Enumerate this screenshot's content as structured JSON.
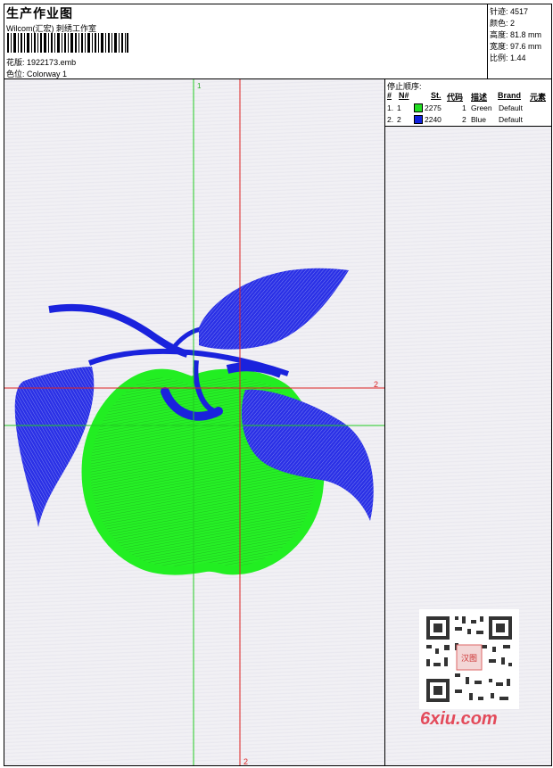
{
  "header": {
    "title": "生产作业图",
    "company": "Wilcom(汇宏) 刺绣工作室",
    "design_label": "花版:",
    "design_file": "1922173.emb",
    "colorway_label": "色位:",
    "colorway": "Colorway 1"
  },
  "stats": {
    "stitches_label": "针迹:",
    "stitches": "4517",
    "colors_label": "颜色:",
    "colors": "2",
    "height_label": "高度:",
    "height": "81.8 mm",
    "width_label": "宽度:",
    "width": "97.6 mm",
    "ratio_label": "比例:",
    "ratio": "1.44"
  },
  "stop_sequence": {
    "title": "停止顺序:",
    "columns": [
      "#",
      "N#",
      "St.",
      "代码",
      "描述",
      "Brand",
      "元素"
    ],
    "rows": [
      {
        "index": "1.",
        "needle": "1",
        "swatch_color": "#22dd22",
        "code": "2275",
        "stop": "1",
        "description": "Green",
        "brand": "Default"
      },
      {
        "index": "2.",
        "needle": "2",
        "swatch_color": "#1122dd",
        "code": "2240",
        "stop": "2",
        "description": "Blue",
        "brand": "Default"
      }
    ]
  },
  "guides": {
    "green_label": "1",
    "red_label_right": "2",
    "red_label_bottom": "2"
  },
  "colors": {
    "green_thread": "#22ee22",
    "blue_thread": "#1a22dd",
    "guide_green": "#22cc22",
    "guide_red": "#dd2222"
  },
  "watermark": {
    "text": "6xiu.com",
    "qr_badge": "汉图"
  }
}
